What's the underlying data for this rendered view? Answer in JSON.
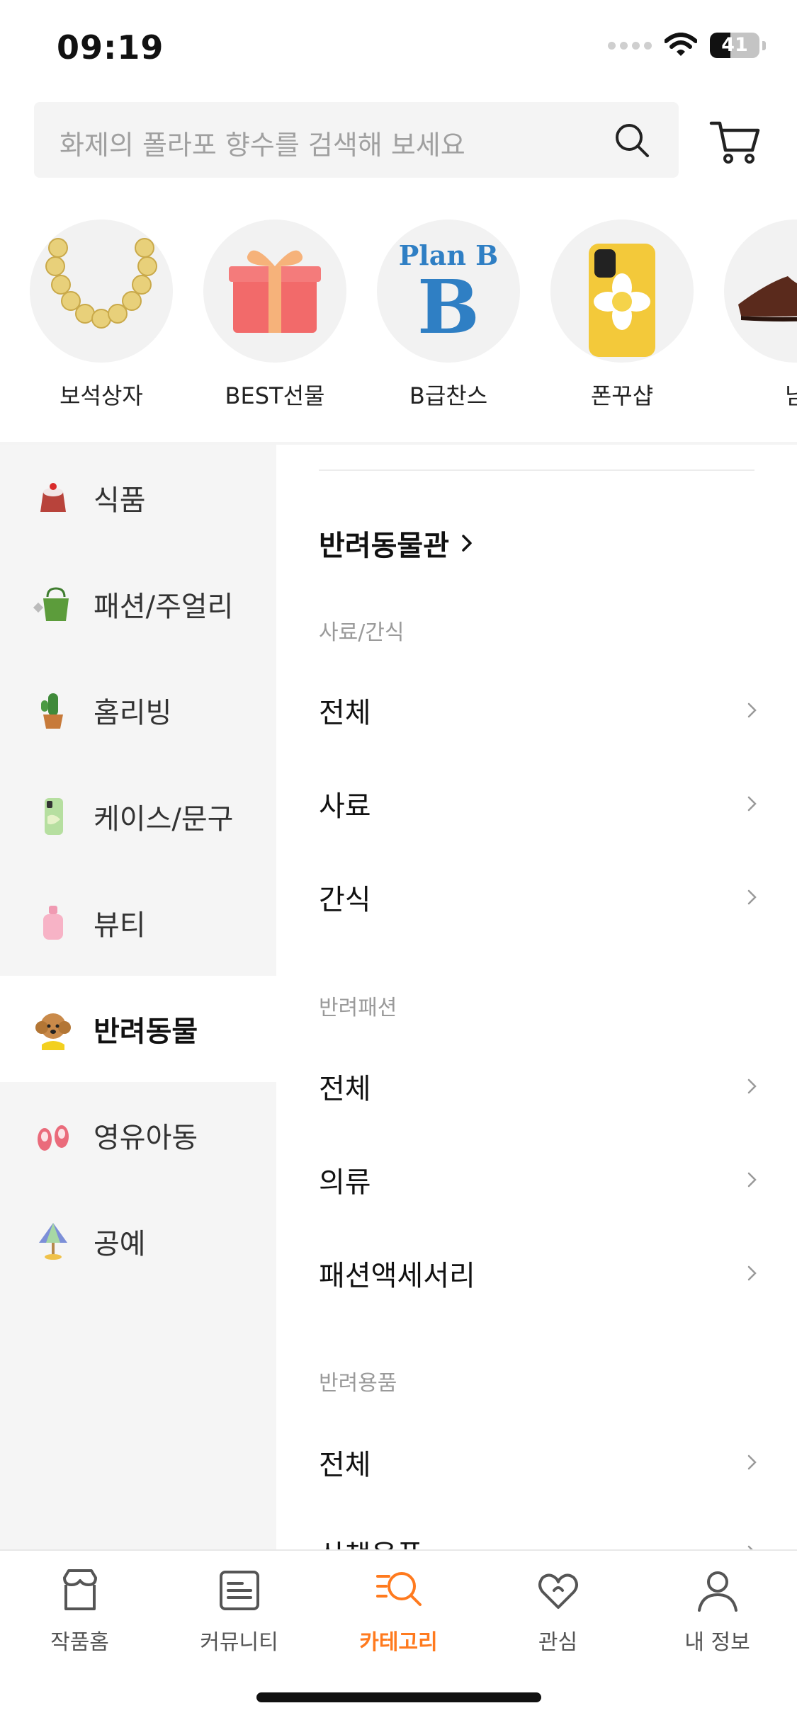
{
  "status_bar": {
    "time": "09:19",
    "battery": "41",
    "battery_level": 0.41
  },
  "search": {
    "placeholder": "화제의 폴라포 향수를 검색해 보세요",
    "icon": "search-icon"
  },
  "header": {
    "cart_icon": "cart-icon"
  },
  "featured": [
    {
      "label": "보석상자",
      "icon": "necklace-icon"
    },
    {
      "label": "BEST선물",
      "icon": "gift-box-icon"
    },
    {
      "label": "B급찬스",
      "icon": "plan-b-logo",
      "logo_text": "Plan B"
    },
    {
      "label": "폰꾸샵",
      "icon": "phone-case-icon"
    },
    {
      "label": "남",
      "icon": "shoe-icon"
    }
  ],
  "categories": [
    {
      "label": "식품",
      "icon": "cake-icon",
      "active": false
    },
    {
      "label": "패션/주얼리",
      "icon": "bag-icon",
      "active": false
    },
    {
      "label": "홈리빙",
      "icon": "cactus-icon",
      "active": false
    },
    {
      "label": "케이스/문구",
      "icon": "phone-case-icon",
      "active": false
    },
    {
      "label": "뷰티",
      "icon": "perfume-icon",
      "active": false
    },
    {
      "label": "반려동물",
      "icon": "dog-icon",
      "active": true
    },
    {
      "label": "영유아동",
      "icon": "baby-shoes-icon",
      "active": false
    },
    {
      "label": "공예",
      "icon": "lamp-icon",
      "active": false
    }
  ],
  "content": {
    "section_title": "반려동물관",
    "groups": [
      {
        "title": "사료/간식",
        "items": [
          "전체",
          "사료",
          "간식"
        ]
      },
      {
        "title": "반려패션",
        "items": [
          "전체",
          "의류",
          "패션액세서리"
        ]
      },
      {
        "title": "반려용품",
        "items": [
          "전체",
          "산책용품"
        ]
      }
    ]
  },
  "bottom_nav": [
    {
      "label": "작품홈",
      "icon": "store-icon",
      "active": false
    },
    {
      "label": "커뮤니티",
      "icon": "community-icon",
      "active": false
    },
    {
      "label": "카테고리",
      "icon": "category-search-icon",
      "active": true
    },
    {
      "label": "관심",
      "icon": "heart-icon",
      "active": false
    },
    {
      "label": "내 정보",
      "icon": "user-icon",
      "active": false
    }
  ],
  "colors": {
    "accent": "#ff7a1e",
    "nav_bg": "#f5f5f5",
    "text": "#111111",
    "muted": "#9a9a9a"
  }
}
